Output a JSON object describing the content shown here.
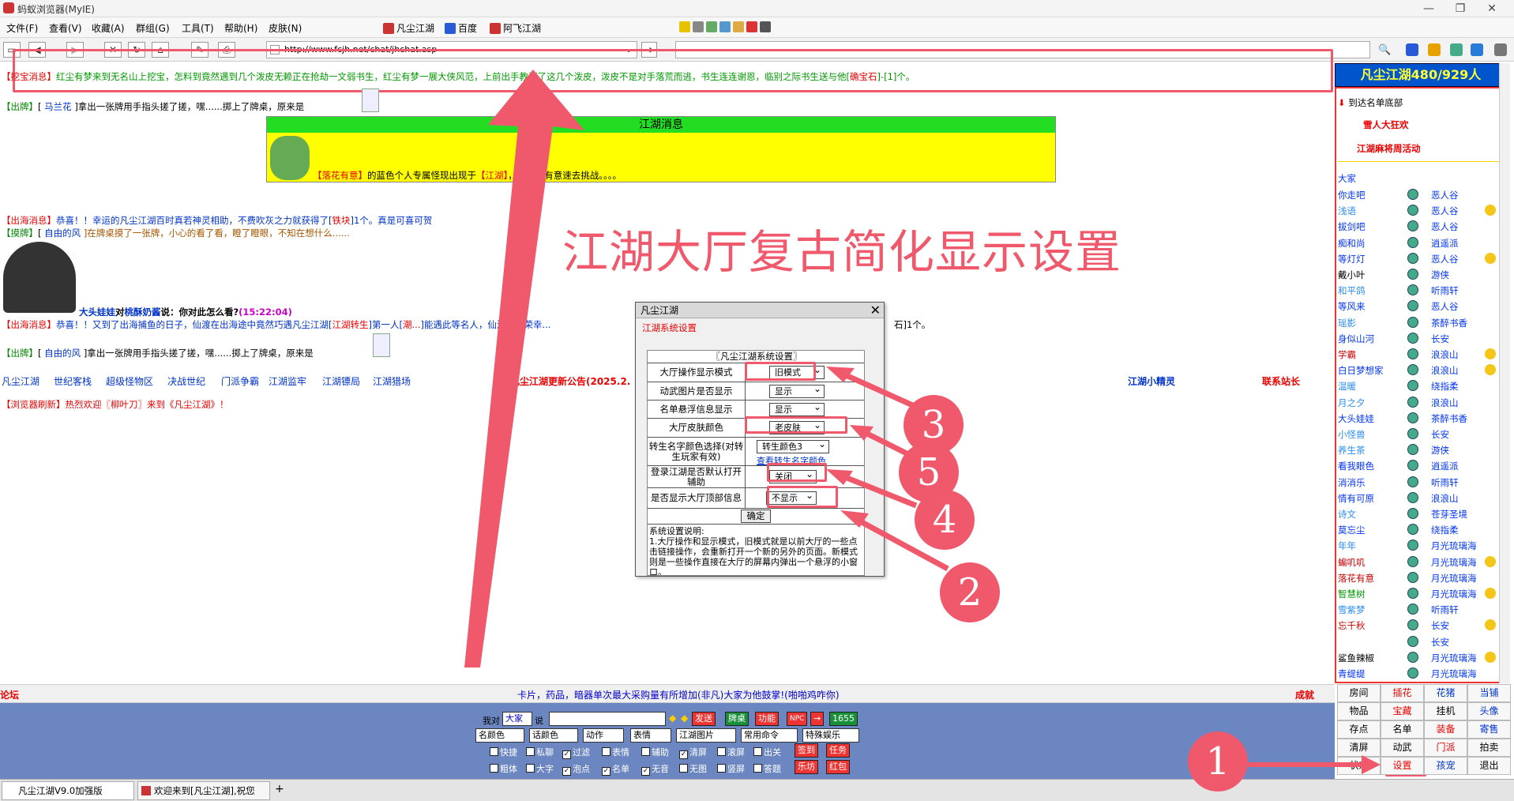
{
  "window": {
    "title": "蚂蚁浏览器(MyIE)"
  },
  "menu": [
    "文件(F)",
    "查看(V)",
    "收藏(A)",
    "群组(G)",
    "工具(T)",
    "帮助(H)",
    "皮肤(N)"
  ],
  "favorites": [
    "凡尘江湖",
    "百度",
    "阿飞江湖"
  ],
  "address": {
    "url": "http://www.fcjh.net/chat/jhchat.asp"
  },
  "chat": {
    "line0": {
      "tag": "【挖宝消息】",
      "text": "红尘有梦来到无名山上挖宝，怎料到竟然遇到几个泼皮无赖正在抢劫一文弱书生，红尘有梦一展大侠风范，上前出手教训了这几个泼皮，泼皮不是对手落荒而逃，书生连连谢恩，临别之际书生送与他[",
      "item": "确宝石",
      "tail": "]-[1]个。"
    },
    "line1": {
      "tag": "【出牌】",
      "name": "马兰花",
      "text": "]拿出一张牌用手指头搓了搓，嘿......掷上了牌桌，原来是"
    },
    "news_header": "江湖消息",
    "news": {
      "name": "【落花有意】",
      "text1": "的蓝色个人专属怪现出现于",
      "loc": "【江湖】",
      "text2": "，请落花有意速去挑战。。。。"
    },
    "line2": {
      "tag": "【出海消息】",
      "text": "恭喜！！幸运的凡尘江湖百时真若神灵相助，不费吹灰之力就获得了[",
      "item": "铁块",
      "tail": "]1个。真是可喜可贺"
    },
    "line3": {
      "tag": "【摸牌】",
      "name": "自由的风",
      "text": "]在牌桌摸了一张牌，小心的看了看，瞪了瞪眼，不知在想什么......"
    },
    "line4": {
      "speaker": "大头娃娃",
      "verb": "对",
      "target": "桃酥奶酱",
      "say": "说：你对此怎么看?",
      "time": "(15:22:04)"
    },
    "line5": {
      "tag": "【出海消息】",
      "text": "恭喜！！又到了出海捕鱼的日子，仙渡在出海途中竟然巧遇凡尘江湖[",
      "item": "江湖转生",
      "tail": "]第一人[",
      "name2": "潮...",
      "tail2": "]能遇此等名人，仙渡深感荣幸...",
      "end": "石]1个。"
    },
    "line6": {
      "tag": "【出牌】",
      "name": "自由的风",
      "text": "]拿出一张牌用手指头搓了搓，嘿......掷上了牌桌，原来是"
    },
    "bracket": "[",
    "line7": {
      "tag": "【浏览器刷新】",
      "text": "热烈欢迎",
      "name": "〖柳叶刀〗",
      "tail": "来到《凡尘江湖》！"
    }
  },
  "overlay_title": "江湖大厅复古简化显示设置",
  "links": [
    "凡尘江湖",
    "世纪客栈",
    "超级怪物区",
    "决战世纪",
    "门派争霸",
    "江湖监牢",
    "江湖镖局",
    "江湖猎场"
  ],
  "announcement": "凡尘江湖更新公告(2025.2.",
  "helper": "江湖小精灵",
  "contact": "联系站长",
  "dialog": {
    "title": "凡尘江湖",
    "subtitle": "江湖系统设置",
    "header": "〖凡尘江湖系统设置〗",
    "rows": [
      {
        "label": "大厅操作显示模式",
        "value": "旧模式"
      },
      {
        "label": "动武图片是否显示",
        "value": "显示"
      },
      {
        "label": "名单悬浮信息显示",
        "value": "显示"
      },
      {
        "label": "大厅皮肤颜色",
        "value": "老皮肤"
      },
      {
        "label": "转生名字颜色选择(对转生玩家有效)",
        "value": "转生颜色3",
        "link": "查看转生名字颜色"
      },
      {
        "label": "登录江湖是否默认打开辅助",
        "value": "关闭"
      },
      {
        "label": "是否显示大厅顶部信息",
        "value": "不显示"
      }
    ],
    "confirm": "确定",
    "desc_title": "系统设置说明:",
    "desc": "1.大厅操作和显示模式，旧模式就是以前大厅的一些点击链接操作，会重新打开一个新的另外的页面。新模式则是一些操作直接在大厅的屏幕内弹出一个悬浮的小窗口。"
  },
  "callouts": [
    "1",
    "2",
    "3",
    "4",
    "5"
  ],
  "right": {
    "title": "凡尘江湖480/929人",
    "goto": "到达名单底部",
    "event1": "雪人大狂欢",
    "event2": "江湖麻将周活动",
    "all": "大家",
    "users": [
      [
        "你走吧",
        "恶人谷"
      ],
      [
        "浅语",
        "恶人谷"
      ],
      [
        "拔剑吧",
        "恶人谷"
      ],
      [
        "痴和尚",
        "逍遥派"
      ],
      [
        "等灯灯",
        "恶人谷"
      ],
      [
        "戴小叶",
        "游侠"
      ],
      [
        "和平鸽",
        "听雨轩"
      ],
      [
        "等风来",
        "恶人谷"
      ],
      [
        "瑶影",
        "茶醉书香"
      ],
      [
        "身似山河",
        "长安"
      ],
      [
        "学霸",
        "浪浪山"
      ],
      [
        "白日梦想家",
        "浪浪山"
      ],
      [
        "温暖",
        "绕指柔"
      ],
      [
        "月之夕",
        "浪浪山"
      ],
      [
        "大头娃娃",
        "茶醉书香"
      ],
      [
        "小怪兽",
        "长安"
      ],
      [
        "养生茶",
        "游侠"
      ],
      [
        "看我眼色",
        "逍遥派"
      ],
      [
        "消消乐",
        "听雨轩"
      ],
      [
        "情有可原",
        "浪浪山"
      ],
      [
        "诗文",
        "苍芽圣境"
      ],
      [
        "莫忘尘",
        "绕指柔"
      ],
      [
        "年年",
        "月光琉璃海"
      ],
      [
        "蝙叽叽",
        "月光琉璃海"
      ],
      [
        "落花有意",
        "月光琉璃海"
      ],
      [
        "智慧树",
        "月光琉璃海"
      ],
      [
        "雪紫梦",
        "听雨轩"
      ],
      [
        "忘千秋",
        "长安"
      ],
      [
        "",
        "长安"
      ],
      [
        "鲨鱼辣椒",
        "月光琉璃海"
      ],
      [
        "青缇缇",
        "月光琉璃海"
      ]
    ]
  },
  "commands": [
    [
      "房间",
      "插花",
      "花猪",
      "当铺"
    ],
    [
      "物品",
      "宝藏",
      "挂机",
      "头像"
    ],
    [
      "存点",
      "名单",
      "装备",
      "寄售"
    ],
    [
      "清屏",
      "动武",
      "门派",
      "拍卖"
    ],
    [
      "状态",
      "设置",
      "孩宠",
      "退出"
    ]
  ],
  "status": {
    "left": "论坛",
    "middle": "卡片，药品，暗器单次最大采购量有所增加(非凡)大家为他鼓掌!(啪啪鸡咋你)",
    "right": "成就"
  },
  "controls": {
    "to_label": "我对",
    "to_value": "大家",
    "say_label": "说",
    "send": "发送",
    "card": "牌桌",
    "func": "功能",
    "npc": "NPC",
    "arrow": "→",
    "count": "1655",
    "selects": [
      "名颜色",
      "话颜色",
      "动作",
      "表情",
      "江湖图片",
      "常用命令",
      "特殊娱乐"
    ],
    "checks1": [
      "快捷",
      "私聊",
      "过滤",
      "表情",
      "辅助",
      "清屏",
      "滚屏",
      "出关"
    ],
    "checks2": [
      "粗体",
      "大字",
      "泡点",
      "名单",
      "无音",
      "无图",
      "竖屏",
      "答题"
    ],
    "btn_signin": "签到",
    "btn_task": "任务",
    "btn_music": "乐坊",
    "btn_red": "红包"
  },
  "tabs": [
    "凡尘江湖V9.0加强版",
    "欢迎来到[凡尘江湖],祝您"
  ],
  "colors": {
    "accent": "#f0596c",
    "panel": "#0055cc",
    "ctrl": "#6b86c0"
  }
}
